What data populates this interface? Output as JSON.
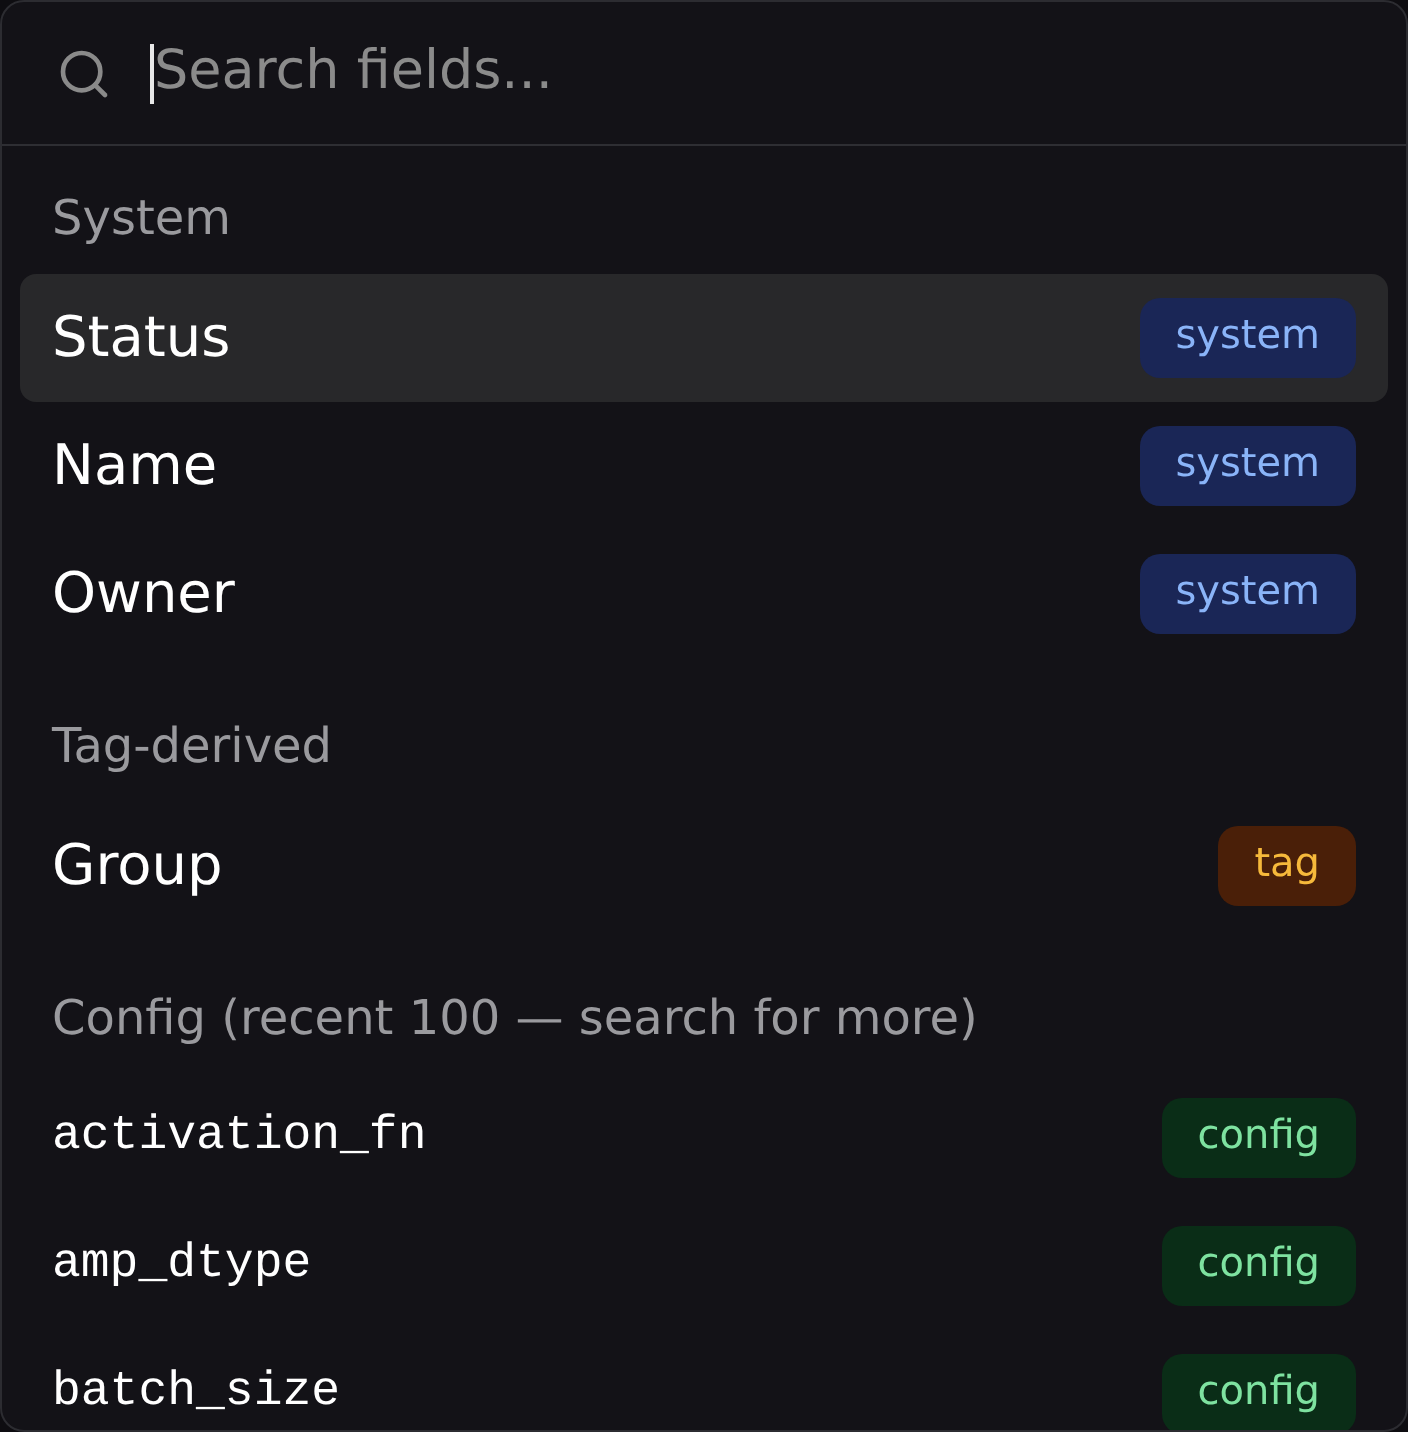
{
  "search": {
    "placeholder": "Search fields...",
    "focused": true
  },
  "sections": [
    {
      "title": "System",
      "kind": "system",
      "items": [
        {
          "name": "Status",
          "badge": "system",
          "selected": true
        },
        {
          "name": "Name",
          "badge": "system",
          "selected": false
        },
        {
          "name": "Owner",
          "badge": "system",
          "selected": false
        }
      ]
    },
    {
      "title": "Tag-derived",
      "kind": "tag",
      "items": [
        {
          "name": "Group",
          "badge": "tag",
          "selected": false
        }
      ]
    },
    {
      "title": "Config (recent 100 — search for more)",
      "kind": "config",
      "items": [
        {
          "name": "activation_fn",
          "badge": "config",
          "selected": false
        },
        {
          "name": "amp_dtype",
          "badge": "config",
          "selected": false
        },
        {
          "name": "batch_size",
          "badge": "config",
          "selected": false
        }
      ]
    }
  ]
}
